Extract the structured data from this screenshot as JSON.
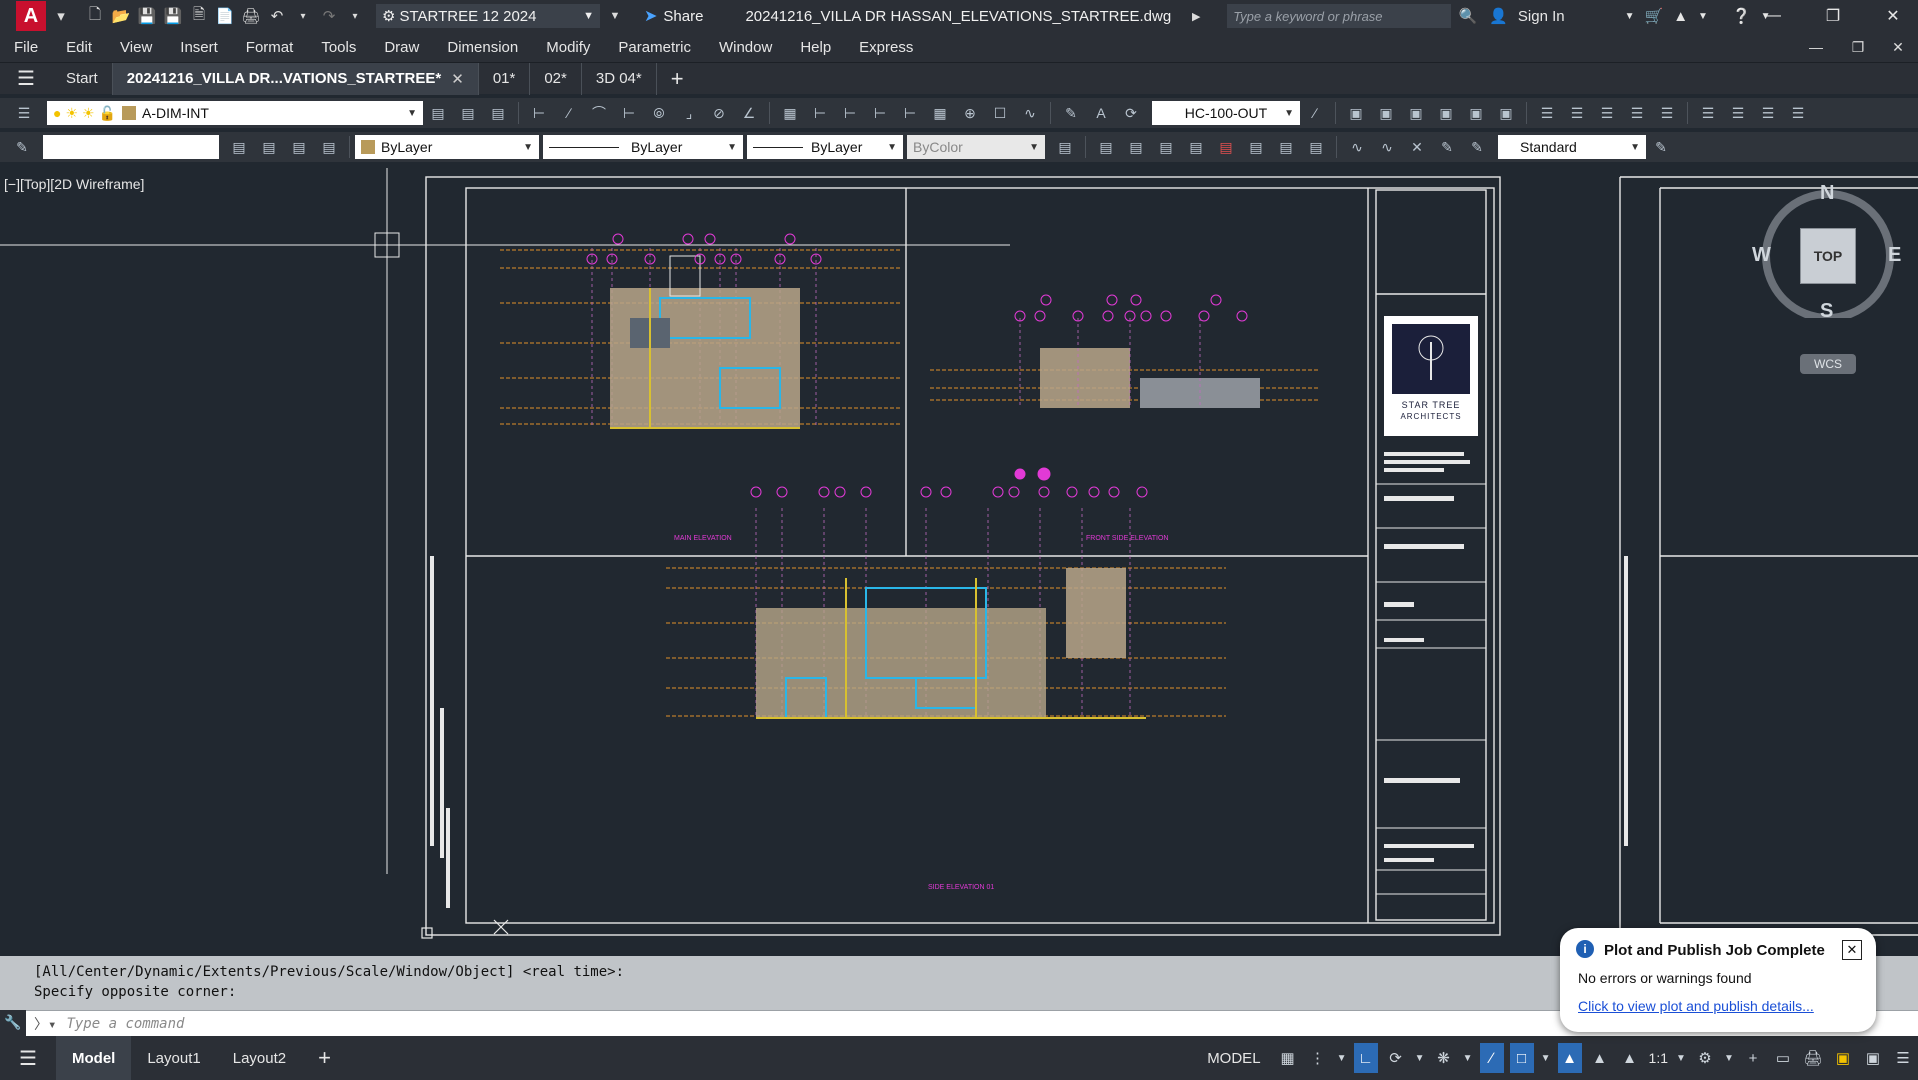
{
  "titlebar": {
    "app_letter": "A",
    "workspace": "STARTREE 12 2024",
    "share": "Share",
    "document_title": "20241216_VILLA DR HASSAN_ELEVATIONS_STARTREE.dwg",
    "search_placeholder": "Type a keyword or phrase",
    "sign_in": "Sign In"
  },
  "menu": [
    "File",
    "Edit",
    "View",
    "Insert",
    "Format",
    "Tools",
    "Draw",
    "Dimension",
    "Modify",
    "Parametric",
    "Window",
    "Help",
    "Express"
  ],
  "tabs": {
    "start": "Start",
    "active_file": "20241216_VILLA DR...VATIONS_STARTREE*",
    "others": [
      "01*",
      "02*",
      "3D 04*"
    ]
  },
  "toolbar1": {
    "layer": "A-DIM-INT",
    "dim_style": "HC-100-OUT"
  },
  "toolbar2": {
    "color": "ByLayer",
    "linetype": "ByLayer",
    "lineweight": "ByLayer",
    "plot_style": "ByColor",
    "text_style": "Standard"
  },
  "viewport": {
    "label": "[−][Top][2D Wireframe]",
    "compass": {
      "n": "N",
      "s": "S",
      "e": "E",
      "w": "W",
      "face": "TOP"
    },
    "ucs": "WCS"
  },
  "sheet": {
    "elevation_titles": [
      "MAIN ELEVATION",
      "FRONT SIDE ELEVATION",
      "SIDE ELEVATION 01"
    ],
    "logo_line1": "STAR TREE",
    "logo_line2": "ARCHITECTS"
  },
  "command": {
    "history": [
      "[All/Center/Dynamic/Extents/Previous/Scale/Window/Object] <real time>:",
      "Specify opposite corner:"
    ],
    "placeholder": "Type a command"
  },
  "statusbar": {
    "layouts": [
      "Model",
      "Layout1",
      "Layout2"
    ],
    "space": "MODEL",
    "scale": "1:1"
  },
  "notification": {
    "title": "Plot and Publish Job Complete",
    "message": "No errors or warnings found",
    "link": "Click to view plot and publish details..."
  },
  "colors": {
    "background": "#212830",
    "accent": "#2c6bb5",
    "magenta": "#e23ad6",
    "orange": "#e0902a",
    "cyan": "#2ab6e8",
    "yellow": "#d8c030"
  }
}
